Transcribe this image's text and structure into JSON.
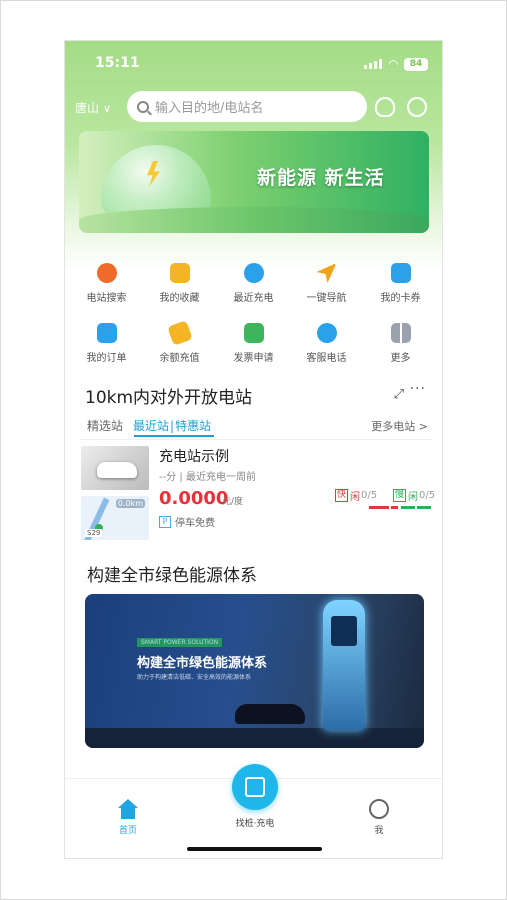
{
  "status": {
    "time": "15:11",
    "battery": "84"
  },
  "header": {
    "city": "唐山",
    "search_placeholder": "输入目的地/电站名"
  },
  "banner": {
    "slogan": "新能源 新生活"
  },
  "quick_actions": [
    {
      "label": "电站搜索",
      "icon": "station-search-icon",
      "color": "#f06a2a"
    },
    {
      "label": "我的收藏",
      "icon": "favorite-star-icon",
      "color": "#f3b526"
    },
    {
      "label": "最近充电",
      "icon": "clock-icon",
      "color": "#2aa1e8"
    },
    {
      "label": "一键导航",
      "icon": "navigation-arrow-icon",
      "color": "#f0a21b"
    },
    {
      "label": "我的卡券",
      "icon": "coupon-icon",
      "color": "#2aa1e8"
    },
    {
      "label": "我的订单",
      "icon": "order-list-icon",
      "color": "#2aa1e8"
    },
    {
      "label": "余额充值",
      "icon": "wallet-icon",
      "color": "#f3b526"
    },
    {
      "label": "发票申请",
      "icon": "invoice-icon",
      "color": "#3cb55c"
    },
    {
      "label": "客服电话",
      "icon": "phone-icon",
      "color": "#2aa1e8"
    },
    {
      "label": "更多",
      "icon": "more-grid-icon",
      "color": "#9aa3ad"
    }
  ],
  "nearby": {
    "title": "10km内对外开放电站",
    "tabs": [
      "精选站",
      "最近站",
      "|",
      "特惠站"
    ],
    "more": "更多电站 >",
    "station": {
      "name": "充电站示例",
      "meta": "--分 | 最近充电一周前",
      "price": "0.0000",
      "unit": "元/度",
      "parking": "停车免费",
      "parking_icon": "P",
      "map_distance": "0.0km",
      "map_road": "S29",
      "fast_tag": "快",
      "fast_label": "闲",
      "fast_count": "0/5",
      "slow_tag": "慢",
      "slow_label": "闲",
      "slow_count": "0/5"
    }
  },
  "promo": {
    "title": "构建全市绿色能源体系",
    "ad_tag": "SMART POWER SOLUTION",
    "ad_title": "构建全市绿色能源体系",
    "ad_sub": "助力于构建清洁低碳、安全高效的能源体系"
  },
  "tabbar": {
    "home": "首页",
    "scan": "找桩·充电",
    "me": "我"
  }
}
